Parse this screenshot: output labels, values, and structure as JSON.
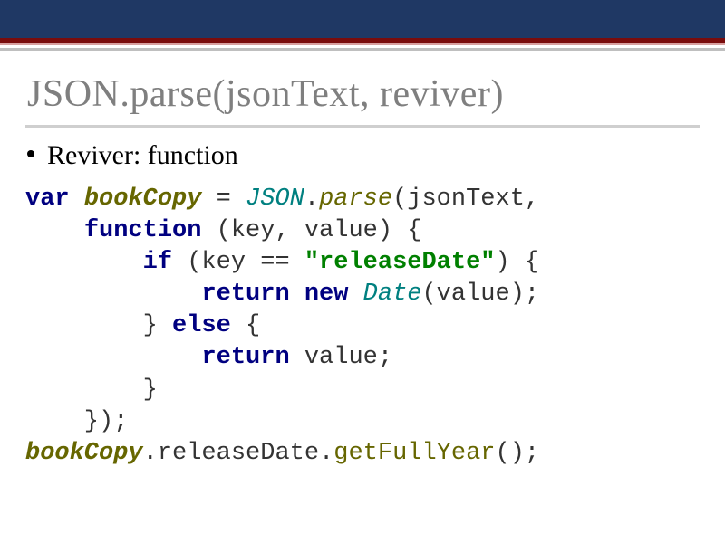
{
  "title": "JSON.parse(jsonText, reviver)",
  "bullet": "Reviver: function",
  "code": {
    "l1a": "var",
    "l1b": "bookCopy",
    "l1c": " = ",
    "l1d": "JSON",
    "l1e": ".",
    "l1f": "parse",
    "l1g": "(jsonText,",
    "l2a": "    ",
    "l2b": "function",
    "l2c": " (key, value) {",
    "l3a": "        ",
    "l3b": "if",
    "l3c": " (key == ",
    "l3d": "\"releaseDate\"",
    "l3e": ") {",
    "l4a": "            ",
    "l4b": "return",
    "l4c": " ",
    "l4d": "new",
    "l4e": " ",
    "l4f": "Date",
    "l4g": "(value);",
    "l5a": "        } ",
    "l5b": "else",
    "l5c": " {",
    "l6a": "            ",
    "l6b": "return",
    "l6c": " value;",
    "l7a": "        }",
    "l8a": "    });",
    "l9a": "bookCopy",
    "l9b": ".releaseDate.",
    "l9c": "getFullYear",
    "l9d": "();"
  }
}
